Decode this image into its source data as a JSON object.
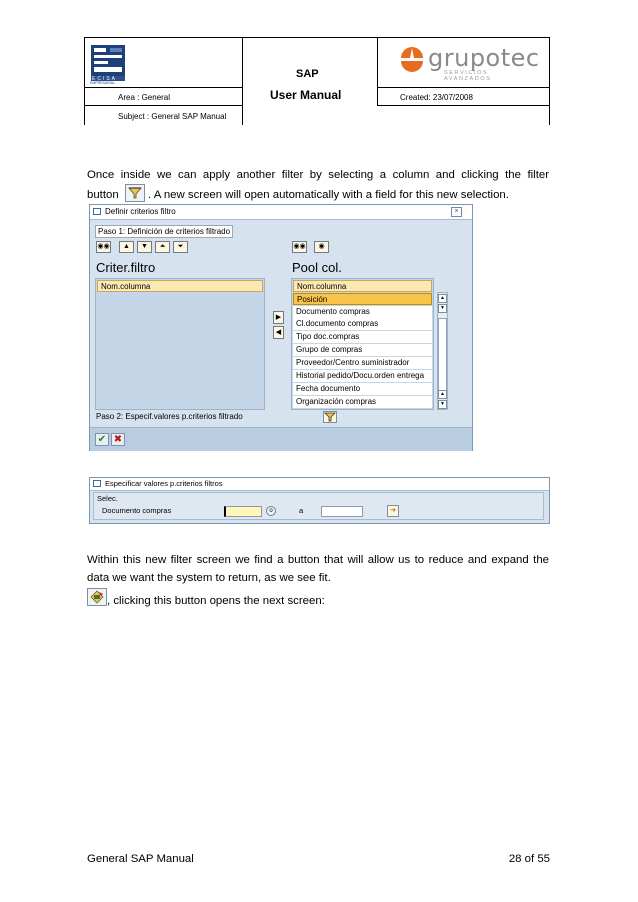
{
  "header": {
    "title_line1": "SAP",
    "title_line2": "User Manual",
    "area": "Area : General",
    "subject": "Subject : General SAP Manual",
    "created": "Created: 23/07/2008",
    "left_logo_text": "ECISA",
    "left_logo_sub": "EMPRESARIAL",
    "right_logo_word": "grupotec",
    "right_logo_sub": "SERVICIOS AVANZADOS",
    "right_logo_color": "#e86b1f"
  },
  "body": {
    "para1_a": "Once inside we can apply another filter by selecting a column and clicking the filter",
    "para1_b_pre": "button",
    "para1_b_post": ". A new screen will open automatically with a field for this new selection.",
    "para2": "Within this new filter screen we find a button that will allow us to reduce and expand the data we want the system to return, as we see fit.",
    "para3": ", clicking this button opens the next screen:"
  },
  "dialog1": {
    "title": "Definir criterios filtro",
    "step1": "Paso 1: Definición de criterios filtrado",
    "left_heading": "Criter.filtro",
    "right_heading": "Pool col.",
    "left_items": [
      "Nom.columna"
    ],
    "right_items": [
      "Nom.columna",
      "Posición",
      "Documento compras",
      "Cl.documento compras",
      "Tipo doc.compras",
      "Grupo de compras",
      "Proveedor/Centro suministrador",
      "Historial pedido/Docu.orden entrega",
      "Fecha documento",
      "Organización compras"
    ],
    "step2": "Paso 2: Especif.valores p.criterios filtrado"
  },
  "dialog2": {
    "title": "Especificar valores p.criterios filtros",
    "group": "Selec.",
    "field_label": "Documento compras",
    "to_label": "a"
  },
  "footer": {
    "left": "General SAP Manual",
    "right": "28 of 55"
  },
  "colors": {
    "sap_bg": "#d6e2ee",
    "highlight": "#f8c54a",
    "input_required": "#fff6b8"
  }
}
